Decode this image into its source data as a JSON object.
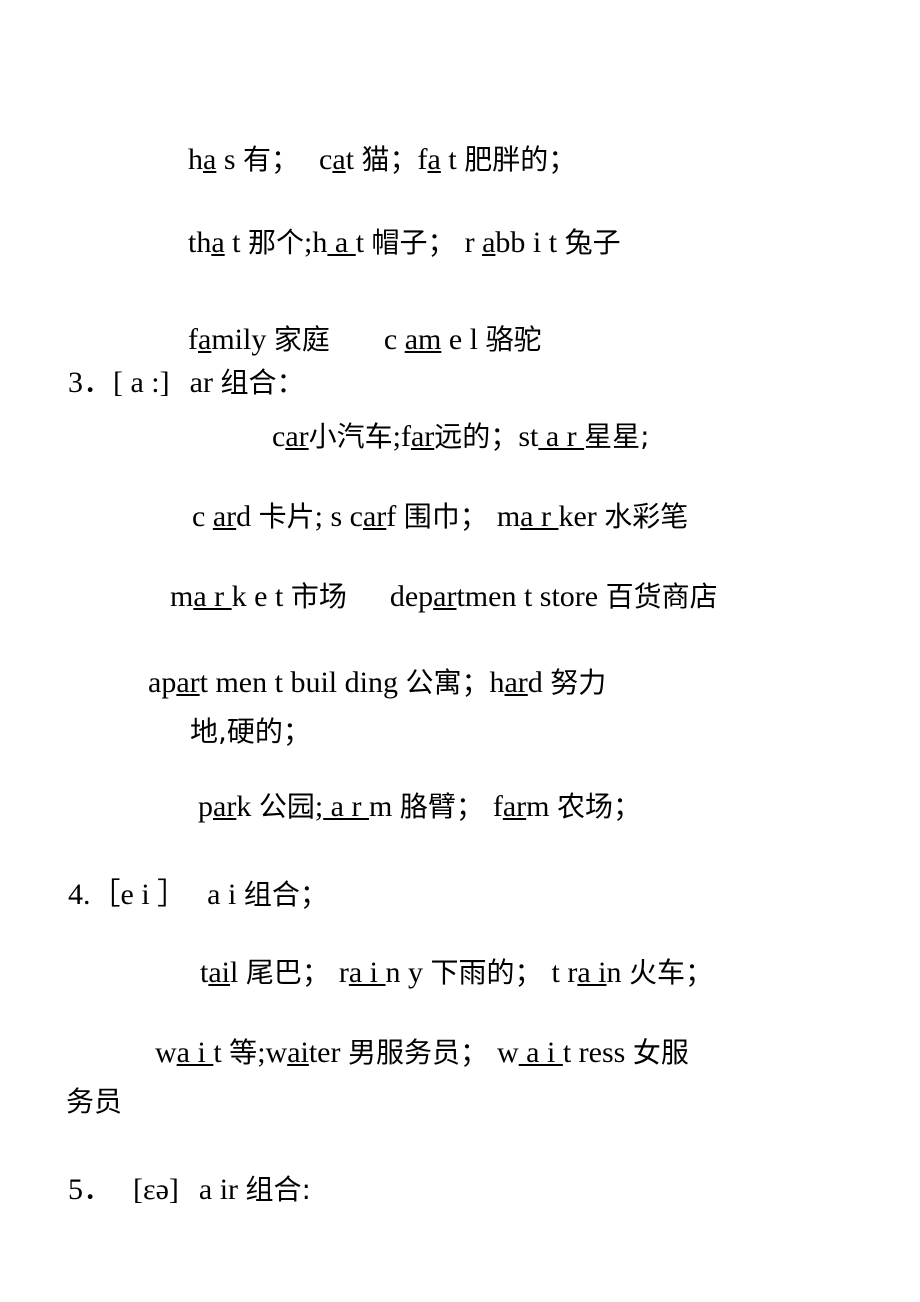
{
  "document": {
    "type": "english-phonics-study-notes",
    "language_mix": "english-chinese",
    "page_background": "#ffffff",
    "text_color": "#000000"
  },
  "sections": [
    {
      "id": "section-2-continued",
      "lines": [
        {
          "id": "line-has-cat-fat",
          "text": "ha s 有； cat 猫；fa t 肥胖的；",
          "entries": [
            {
              "word": "has",
              "underlined": "ha",
              "gloss": "有"
            },
            {
              "word": "cat",
              "underlined": "a",
              "gloss": "猫"
            },
            {
              "word": "fat",
              "underlined": "fa",
              "gloss": "肥胖的"
            }
          ]
        },
        {
          "id": "line-that-hat-rabbit",
          "text": "tha t 那个;h a  t 帽子； r abb i t 兔子",
          "entries": [
            {
              "word": "that",
              "underlined": "a",
              "gloss": "那个"
            },
            {
              "word": "hat",
              "underlined": "a",
              "gloss": "帽子"
            },
            {
              "word": "rabbit",
              "underlined": "a",
              "gloss": "兔子"
            }
          ]
        },
        {
          "id": "line-family-camel",
          "text": "family 家庭    c am e l 骆驼",
          "entries": [
            {
              "word": "family",
              "underlined": "a",
              "gloss": "家庭"
            },
            {
              "word": "camel",
              "underlined": "am",
              "gloss": "骆驼"
            }
          ]
        }
      ]
    },
    {
      "id": "section-3",
      "number": "3．",
      "phonetic": "[ a :]",
      "combination": "ar 组合：",
      "lines": [
        {
          "id": "line-car-far-star",
          "text": "car 小汽车;far 远的； st a  r 星星;",
          "entries": [
            {
              "word": "car",
              "underlined": "ar",
              "gloss": "小汽车"
            },
            {
              "word": "far",
              "underlined": "ar",
              "gloss": "远的"
            },
            {
              "word": "star",
              "underlined": "a r",
              "gloss": "星星"
            }
          ]
        },
        {
          "id": "line-card-scarf-marker",
          "text": "c ard 卡片; s carf 围巾； ma r ker 水彩笔",
          "entries": [
            {
              "word": "card",
              "underlined": "ar",
              "gloss": "卡片"
            },
            {
              "word": "scarf",
              "underlined": "ar",
              "gloss": "围巾"
            },
            {
              "word": "marker",
              "underlined": "a r",
              "gloss": "水彩笔"
            }
          ]
        },
        {
          "id": "line-market-department-store",
          "text": "ma r k e t 市场    department store 百货商店",
          "entries": [
            {
              "word": "market",
              "underlined": "a r",
              "gloss": "市场"
            },
            {
              "word": "department store",
              "underlined": "ar",
              "gloss": "百货商店"
            }
          ]
        },
        {
          "id": "line-apartment-hard",
          "text": "apart men t  buil ding 公寓；hard 努力地,硬的；",
          "wrapped_text": "地,硬的；",
          "entries": [
            {
              "word": "apartment building",
              "underlined": "ar",
              "gloss": "公寓"
            },
            {
              "word": "hard",
              "underlined": "ar",
              "gloss": "努力地,硬的"
            }
          ]
        },
        {
          "id": "line-park-arm-farm",
          "text": "park 公园; a  r m 胳臂； farm 农场；",
          "entries": [
            {
              "word": "park",
              "underlined": "ar",
              "gloss": "公园"
            },
            {
              "word": "arm",
              "underlined": "a r",
              "gloss": "胳臂"
            },
            {
              "word": "farm",
              "underlined": "ar",
              "gloss": "农场"
            }
          ]
        }
      ]
    },
    {
      "id": "section-4",
      "number": "4．",
      "phonetic": "［e i ］",
      "combination": "a i 组合；",
      "lines": [
        {
          "id": "line-tail-rainy-train",
          "text": "tail 尾巴； ra i n y 下雨的； t r a i n 火车；",
          "entries": [
            {
              "word": "tail",
              "underlined": "ai",
              "gloss": "尾巴"
            },
            {
              "word": "rainy",
              "underlined": "a i",
              "gloss": "下雨的"
            },
            {
              "word": "train",
              "underlined": "a i",
              "gloss": "火车"
            }
          ]
        },
        {
          "id": "line-wait-waiter-waitress",
          "text": "wa i  t 等;waiter 男服务员； w a  i  t ress 女服务员",
          "wrapped_text": "务员",
          "entries": [
            {
              "word": "wait",
              "underlined": "a i",
              "gloss": "等"
            },
            {
              "word": "waiter",
              "underlined": "ai",
              "gloss": "男服务员"
            },
            {
              "word": "waitress",
              "underlined": "a  i",
              "gloss": "女服务员"
            }
          ]
        }
      ]
    },
    {
      "id": "section-5",
      "number": "5．",
      "phonetic": "[εə]",
      "combination": "a ir 组合:",
      "lines": []
    }
  ],
  "fragments": {
    "l1_a": "h",
    "l1_b": "a",
    "l1_c": " s ",
    "l1_d": "有；",
    "l1_e": "c",
    "l1_f": "a",
    "l1_g": "t ",
    "l1_h": "猫；",
    "l1_i": "f",
    "l1_j": "a",
    "l1_k": " t ",
    "l1_l": "肥胖的；",
    "l2_a": "th",
    "l2_b": "a",
    "l2_c": " t ",
    "l2_d": "那个",
    "l2_e": ";h",
    "l2_f": " a ",
    "l2_g": " t ",
    "l2_h": "帽子；",
    "l2_i": "r ",
    "l2_j": "a",
    "l2_k": "bb i t ",
    "l2_l": "兔子",
    "l3_a": "f",
    "l3_b": "a",
    "l3_c": "mily ",
    "l3_d": "家庭",
    "l3_e": "c ",
    "l3_f": "am",
    "l3_g": " e  l ",
    "l3_h": "骆驼",
    "h3_num": "3．",
    "h3_ipa": "[ a :]",
    "h3_cmb": "ar ",
    "h3_cn": "组合：",
    "l4_a": "c",
    "l4_b": "ar",
    "l4_c": "小汽车",
    "l4_d": ";f",
    "l4_e": "ar",
    "l4_f": "远的；",
    "l4_g": "st",
    "l4_h": " a  r ",
    "l4_i": "星星;",
    "l5_a": "c ",
    "l5_b": "ar",
    "l5_c": "d ",
    "l5_d": "卡片",
    "l5_e": "; s c",
    "l5_f": "ar",
    "l5_g": "f ",
    "l5_h": "围巾；",
    "l5_i": "m",
    "l5_j": "a r ",
    "l5_k": "ker ",
    "l5_l": "水彩笔",
    "l6_a": "m",
    "l6_b": "a r ",
    "l6_c": "k e t ",
    "l6_d": "市场",
    "l6_e": "dep",
    "l6_f": "ar",
    "l6_g": "tmen t  store ",
    "l6_h": "百货商店",
    "l7_a": "ap",
    "l7_b": "ar",
    "l7_c": "t men t   buil  ding ",
    "l7_d": "公寓；",
    "l7_e": "h",
    "l7_f": "ar",
    "l7_g": "d ",
    "l7_h": "努力",
    "l7_wrap": "地,硬的；",
    "l8_a": "p",
    "l8_b": "ar",
    "l8_c": "k ",
    "l8_d": "公园",
    "l8_e": ";",
    "l8_f": " a  r ",
    "l8_g": "m ",
    "l8_h": "胳臂；",
    "l8_i": "f",
    "l8_j": "ar",
    "l8_k": "m ",
    "l8_l": "农场；",
    "h4_num": "4.",
    "h4_ipa": "［e i ］",
    "h4_cmb": "a i ",
    "h4_cn": "组合；",
    "l9_a": "t",
    "l9_b": "ai",
    "l9_c": "l ",
    "l9_d": "尾巴；",
    "l9_e": "r",
    "l9_f": "a i ",
    "l9_g": "n y ",
    "l9_h": "下雨的；",
    "l9_i": "t r",
    "l9_j": "a i",
    "l9_k": "n ",
    "l9_l": "火车；",
    "l10_a": "w",
    "l10_b": "a i ",
    "l10_c": " t ",
    "l10_d": "等",
    "l10_e": ";w",
    "l10_f": "ai",
    "l10_g": "ter ",
    "l10_h": "男服务员；",
    "l10_i": "w",
    "l10_j": " a  i ",
    "l10_k": " t ress ",
    "l10_l": "女服",
    "l10_wrap": "务员",
    "h5_num": "5．",
    "h5_ipa": "[εə]",
    "h5_cmb": "a ir ",
    "h5_cn": "组合:"
  }
}
